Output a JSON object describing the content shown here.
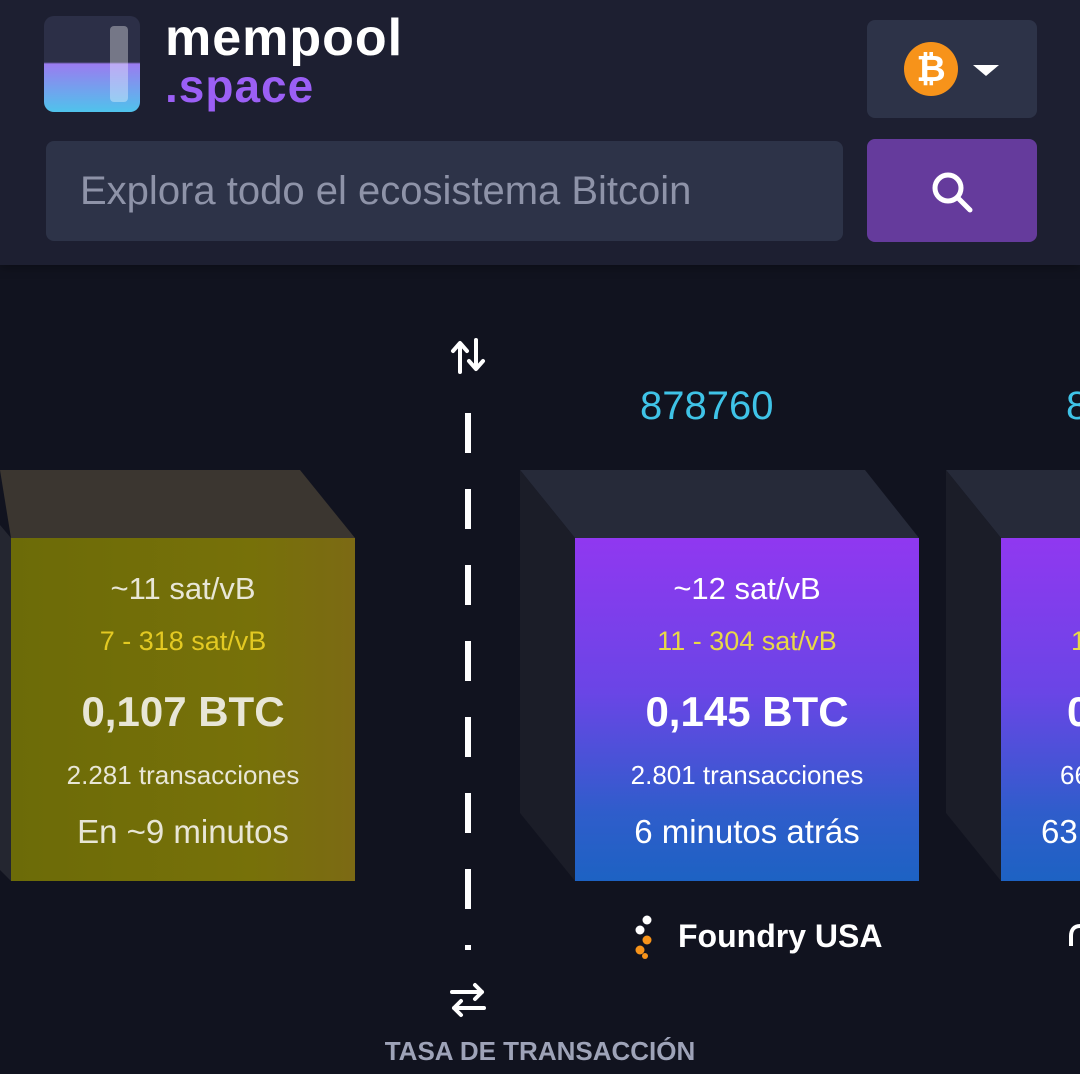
{
  "header": {
    "logo_word_1": "mempool",
    "logo_word_2": ".space",
    "network_symbol": "₿",
    "network_icon": "bitcoin-icon",
    "search_placeholder": "Explora todo el ecosistema Bitcoin",
    "search_icon": "search-icon"
  },
  "blockchain": {
    "divider_top_icon": "sort-arrows-icon",
    "divider_bottom_icon": "swap-arrows-icon",
    "fee_label": "TASA DE TRANSACCIÓN",
    "pending_block": {
      "median_fee": "~11 sat/vB",
      "fee_range": "7 - 318 sat/vB",
      "total": "0,107 BTC",
      "tx_count": "2.281 transacciones",
      "eta": "En ~9 minutos"
    },
    "mined_block": {
      "height": "878760",
      "median_fee": "~12 sat/vB",
      "fee_range": "11 - 304 sat/vB",
      "total": "0,145 BTC",
      "tx_count": "2.801 transacciones",
      "time_ago": "6 minutos atrás",
      "pool_name": "Foundry USA",
      "pool_icon": "foundry-logo-icon"
    },
    "mined_block_partial": {
      "height_partial": "8",
      "fee_range_partial": "1",
      "total_partial": "0",
      "tx_partial": "66",
      "time_partial": "63",
      "pool_partial_icon": "pool-logo-icon"
    }
  },
  "colors": {
    "background": "#11131f",
    "header": "#1d1f31",
    "accent_purple": "#653b9c",
    "block_height": "#3fc3e7",
    "fee_range": "#e8d847",
    "bitcoin_orange": "#f7931a"
  }
}
